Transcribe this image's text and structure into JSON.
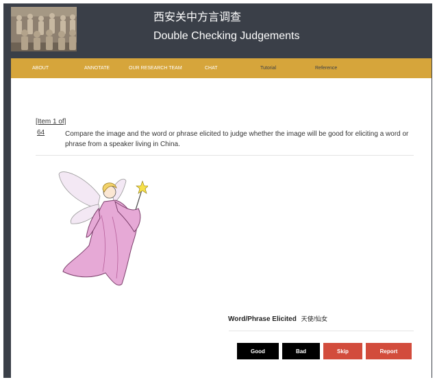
{
  "header": {
    "title": "西安关中方言调查",
    "subtitle": "Double Checking Judgements"
  },
  "nav": {
    "items": [
      "ABOUT",
      "ANNOTATE",
      "OUR RESEARCH TEAM",
      "CHAT",
      "Tutorial",
      "Reference"
    ]
  },
  "item": {
    "counter": "[Item 1 of]",
    "number": "64",
    "instructions": "Compare the image and the word or phrase elicited to judge whether the image will be good for eliciting a word or phrase from a speaker living in China."
  },
  "elicited": {
    "label": "Word/Phrase Elicited",
    "value": "天使/仙女"
  },
  "actions": {
    "good": "Good",
    "bad": "Bad",
    "skip": "Skip",
    "report": "Report"
  },
  "colors": {
    "header_bg": "#3a3f48",
    "nav_bg": "#d6a53b",
    "primary_button": "#000000",
    "danger_button": "#d24c3c"
  }
}
